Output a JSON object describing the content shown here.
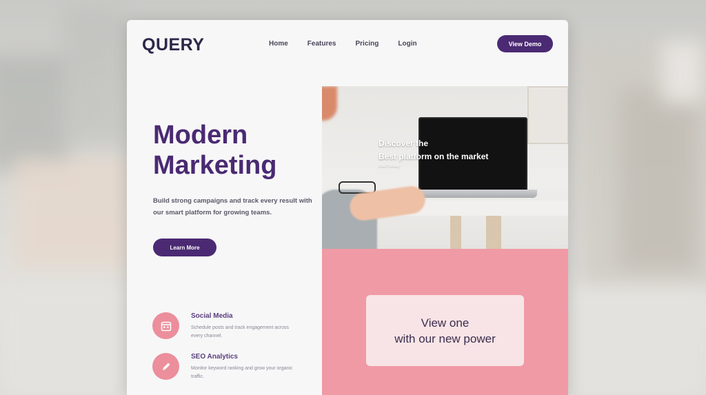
{
  "site": {
    "logo": "QUERY",
    "nav": [
      "Home",
      "Features",
      "Pricing",
      "Login"
    ],
    "cta_top": "View Demo",
    "hero": {
      "title_line1": "Modern",
      "title_line2": "Marketing",
      "description": "Build strong campaigns and track every result with our smart platform for growing teams.",
      "button": "Learn More"
    },
    "features": [
      {
        "title": "Social Media",
        "desc": "Schedule posts and track engagement across every channel."
      },
      {
        "title": "SEO Analytics",
        "desc": "Monitor keyword ranking and grow your organic traffic."
      }
    ],
    "photo_overlay": {
      "line1": "Discover the",
      "line2": "Best platform on the market",
      "small": "start today"
    },
    "pink_card": {
      "line1": "View one",
      "line2": "with our new power"
    }
  },
  "colors": {
    "brand": "#4b2a73",
    "pink": "#f09aa5",
    "card": "#f8e4e6"
  }
}
